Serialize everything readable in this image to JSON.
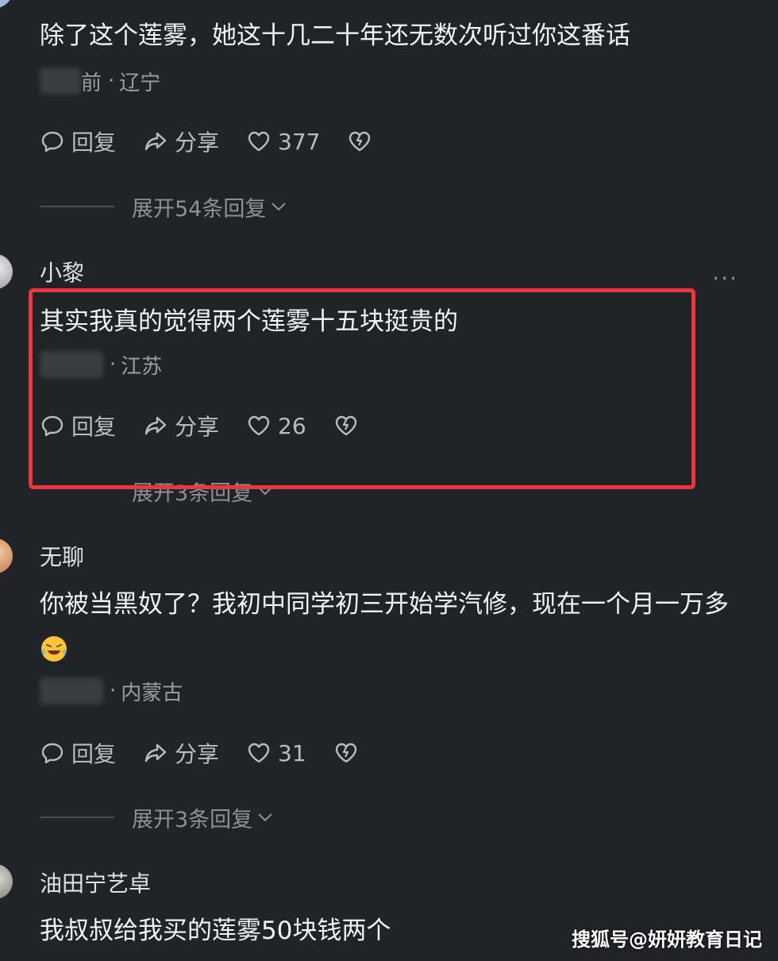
{
  "comments": [
    {
      "username": "",
      "content": "除了这个莲雾，她这十几二十年还无数次听过你这番话",
      "meta_time": "前",
      "meta_sep": "·",
      "meta_location": "辽宁",
      "reply_label": "回复",
      "share_label": "分享",
      "likes": "377",
      "expand_label": "展开54条回复"
    },
    {
      "username": "小黎",
      "content": "其实我真的觉得两个莲雾十五块挺贵的",
      "meta_sep": "·",
      "meta_location": "江苏",
      "reply_label": "回复",
      "share_label": "分享",
      "likes": "26",
      "expand_label": "展开3条回复",
      "more": "···"
    },
    {
      "username": "无聊",
      "content": "你被当黑奴了？我初中同学初三开始学汽修，现在一个月一万多",
      "meta_sep": "·",
      "meta_location": "内蒙古",
      "reply_label": "回复",
      "share_label": "分享",
      "likes": "31",
      "expand_label": "展开3条回复"
    },
    {
      "username": "油田宁艺卓",
      "content": "我叔叔给我买的莲雾50块钱两个"
    }
  ],
  "watermark": "搜狐号@妍妍教育日记",
  "icons": {
    "reply": "comment-bubble-icon",
    "share": "share-arrow-icon",
    "like": "heart-icon",
    "dislike": "broken-heart-icon",
    "chevron": "chevron-down-icon",
    "emoji": "laughing-crying-emoji-icon"
  },
  "colors": {
    "background": "#212326",
    "highlight_border": "#e8383d"
  }
}
